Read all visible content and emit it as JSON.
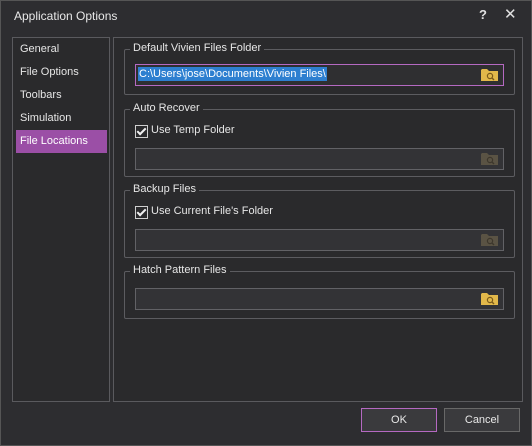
{
  "window": {
    "title": "Application Options"
  },
  "titlebar": {
    "help": "?",
    "close": "✕"
  },
  "sidebar": {
    "items": [
      {
        "label": "General"
      },
      {
        "label": "File Options"
      },
      {
        "label": "Toolbars"
      },
      {
        "label": "Simulation"
      },
      {
        "label": "File Locations",
        "selected": true
      }
    ]
  },
  "default_folder": {
    "label": "Default Vivien Files Folder",
    "value": "C:\\Users\\jose\\Documents\\Vivien Files\\"
  },
  "auto_recover": {
    "label": "Auto Recover",
    "checkbox": "Use Temp Folder",
    "checked": true,
    "value": ""
  },
  "backup_files": {
    "label": "Backup Files",
    "checkbox": "Use Current File's Folder",
    "checked": true,
    "value": ""
  },
  "hatch_files": {
    "label": "Hatch Pattern Files",
    "value": ""
  },
  "buttons": {
    "ok": "OK",
    "cancel": "Cancel"
  },
  "colors": {
    "accent": "#9b4fa6",
    "selection": "#2d7fd0",
    "folder": "#e2b84a"
  }
}
